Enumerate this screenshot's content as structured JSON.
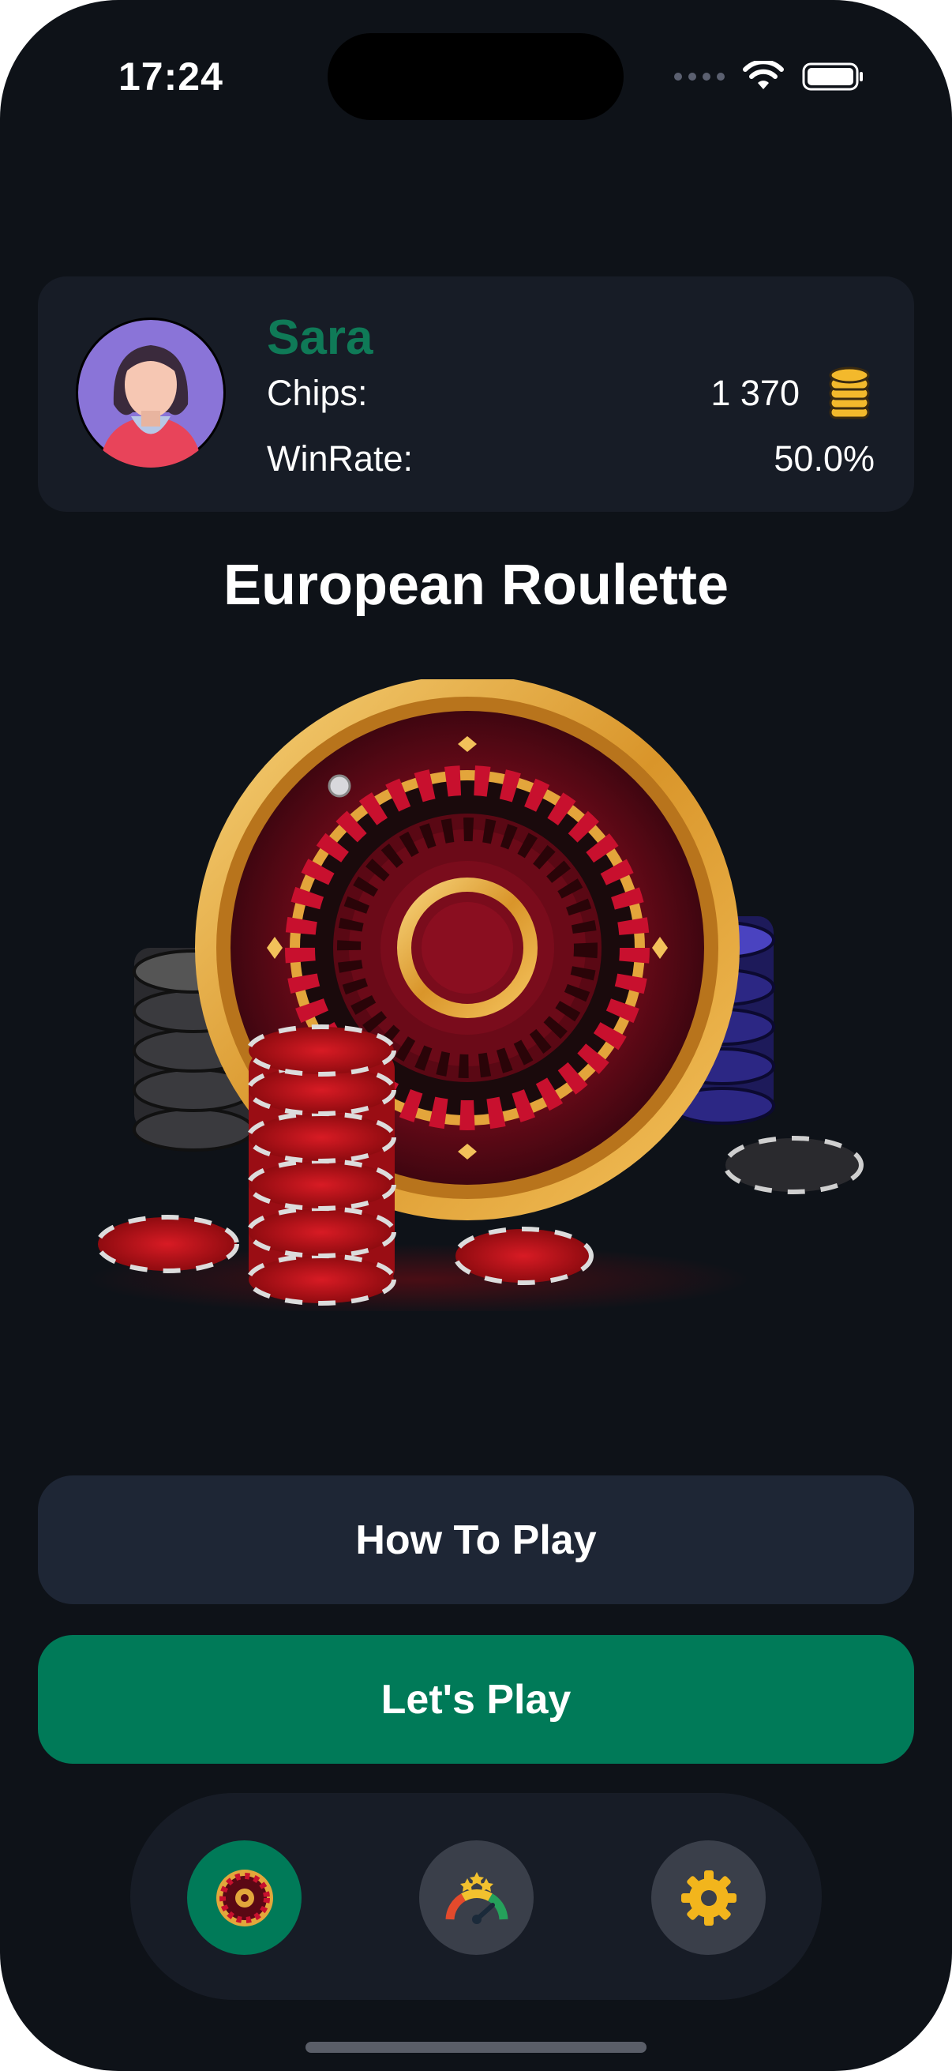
{
  "status_bar": {
    "time": "17:24"
  },
  "profile": {
    "name": "Sara",
    "chips_label": "Chips:",
    "chips_value": "1 370",
    "winrate_label": "WinRate:",
    "winrate_value": "50.0%"
  },
  "title": "European Roulette",
  "buttons": {
    "how_to_play": "How To Play",
    "lets_play": "Let's Play"
  },
  "tabbar": {
    "items": [
      {
        "icon": "roulette-icon",
        "active": true
      },
      {
        "icon": "rating-gauge-icon",
        "active": false
      },
      {
        "icon": "gear-icon",
        "active": false
      }
    ]
  },
  "colors": {
    "background": "#0e1218",
    "card": "#171c26",
    "accent_green": "#007a58",
    "name_green": "#0f7a57",
    "secondary_button": "#1e2635"
  }
}
